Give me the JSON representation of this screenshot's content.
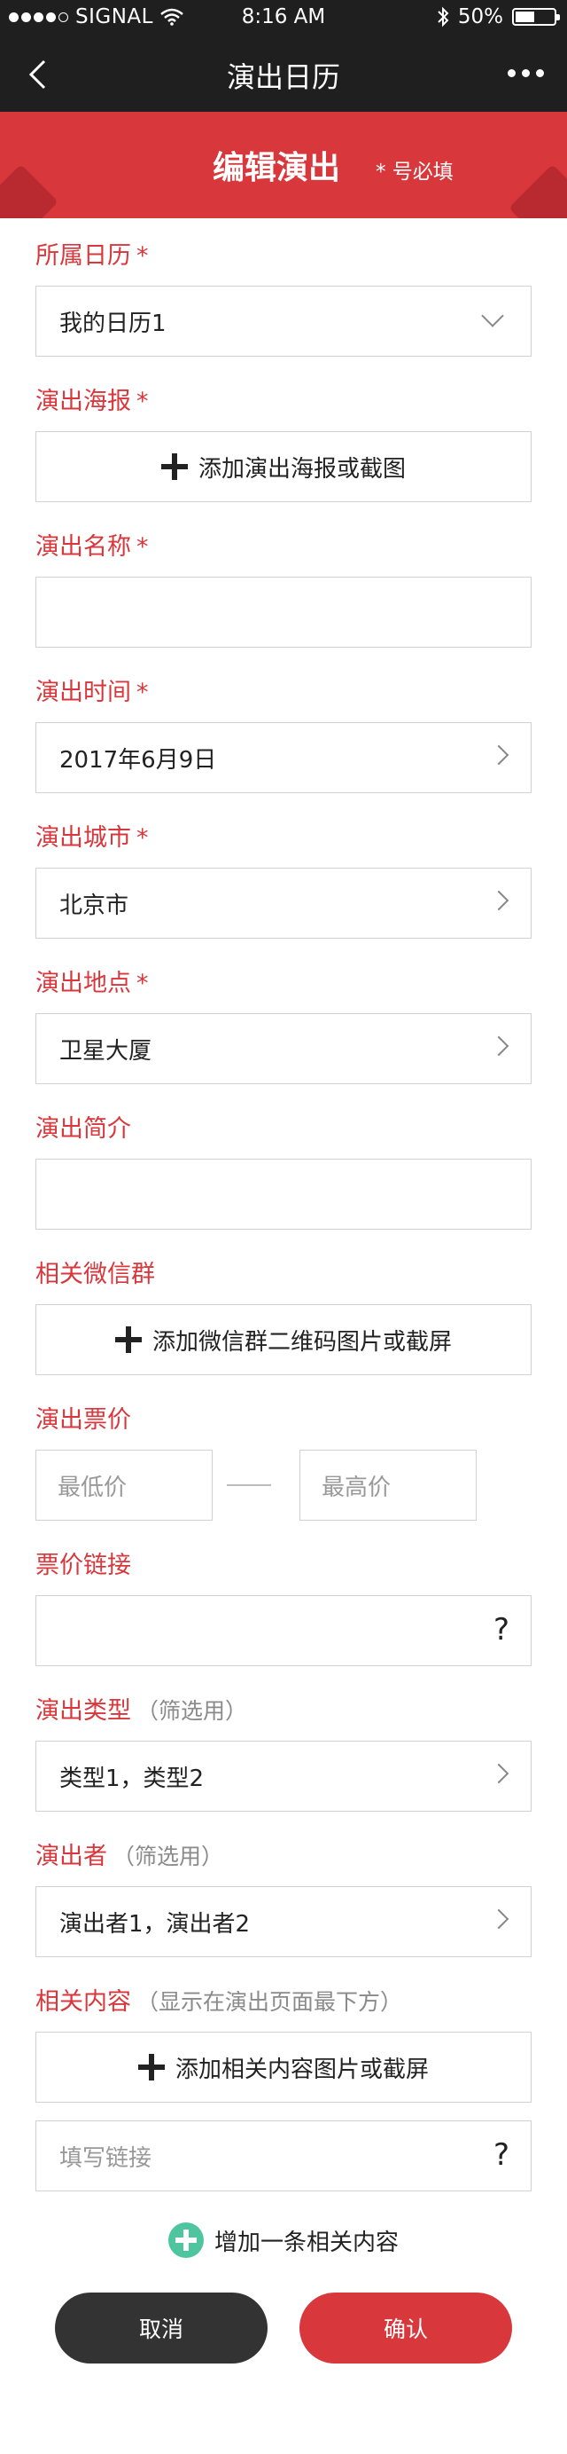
{
  "status_bar": {
    "carrier": "SIGNAL",
    "time": "8:16 AM",
    "battery_text": "50%",
    "battery_level": 0.5
  },
  "nav": {
    "title": "演出日历"
  },
  "banner": {
    "title": "编辑演出",
    "note": "* 号必填"
  },
  "form": {
    "calendar": {
      "label": "所属日历",
      "required": "*",
      "value": "我的日历1"
    },
    "poster": {
      "label": "演出海报",
      "required": "*",
      "button": "添加演出海报或截图"
    },
    "name": {
      "label": "演出名称",
      "required": "*",
      "value": ""
    },
    "time": {
      "label": "演出时间",
      "required": "*",
      "value": "2017年6月9日"
    },
    "city": {
      "label": "演出城市",
      "required": "*",
      "value": "北京市"
    },
    "venue": {
      "label": "演出地点",
      "required": "*",
      "value": "卫星大厦"
    },
    "intro": {
      "label": "演出简介",
      "value": ""
    },
    "wechat": {
      "label": "相关微信群",
      "button": "添加微信群二维码图片或截屏"
    },
    "price": {
      "label": "演出票价",
      "min_placeholder": "最低价",
      "max_placeholder": "最高价"
    },
    "ticket_link": {
      "label": "票价链接",
      "help": "?"
    },
    "type": {
      "label": "演出类型",
      "hint": "（筛选用）",
      "value": "类型1，类型2"
    },
    "performer": {
      "label": "演出者",
      "hint": "（筛选用）",
      "value": "演出者1，演出者2"
    },
    "related": {
      "label": "相关内容",
      "hint": "（显示在演出页面最下方）",
      "button": "添加相关内容图片或截屏",
      "link_placeholder": "填写链接",
      "help": "?",
      "add_more": "增加一条相关内容"
    }
  },
  "actions": {
    "cancel": "取消",
    "confirm": "确认"
  },
  "colors": {
    "accent": "#d8373c",
    "dark": "#1f1f1f",
    "add_green": "#4fc59f"
  }
}
